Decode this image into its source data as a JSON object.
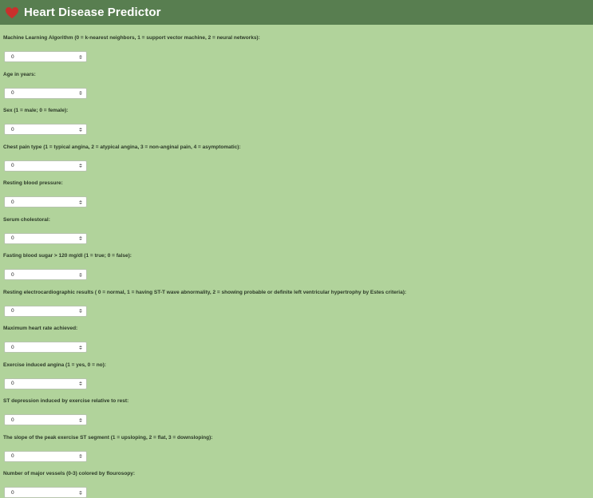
{
  "header": {
    "title": "Heart Disease Predictor",
    "icon": "heart-icon",
    "icon_color": "#c9302c",
    "background": "#587e50"
  },
  "page": {
    "background": "#b1d39b"
  },
  "fields": [
    {
      "label": "Machine Learning Algorithm (0 = k-nearest neighbors, 1 = support vector machine, 2 = neural networks):",
      "value": "0"
    },
    {
      "label": "Age in years:",
      "value": "0"
    },
    {
      "label": "Sex (1 = male; 0 = female):",
      "value": "0"
    },
    {
      "label": "Chest pain type (1 = typical angina, 2 = atypical angina, 3 = non-anginal pain, 4 = asymptomatic):",
      "value": "0"
    },
    {
      "label": "Resting blood pressure:",
      "value": "0"
    },
    {
      "label": "Serum cholestoral:",
      "value": "0"
    },
    {
      "label": "Fasting blood sugar > 120 mg/dl (1 = true; 0 = false):",
      "value": "0"
    },
    {
      "label": "Resting electrocardiographic results ( 0 = normal, 1 = having ST-T wave abnormality, 2 = showing probable or definite left ventricular hypertrophy by Estes criteria):",
      "value": "0"
    },
    {
      "label": "Maximum heart rate achieved:",
      "value": "0"
    },
    {
      "label": "Exercise induced angina (1 = yes, 0 = no):",
      "value": "0"
    },
    {
      "label": "ST depression induced by exercise relative to rest:",
      "value": "0"
    },
    {
      "label": "The slope of the peak exercise ST segment (1 = upsloping, 2 = flat, 3 = downsloping):",
      "value": "0"
    },
    {
      "label": "Number of major vessels (0-3) colored by flourosopy:",
      "value": "0"
    }
  ]
}
